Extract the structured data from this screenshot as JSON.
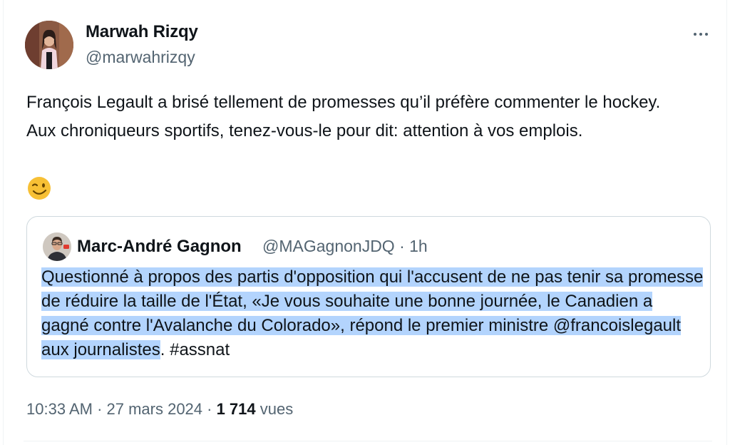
{
  "author": {
    "name": "Marwah Rizqy",
    "handle": "@marwahrizqy"
  },
  "more_menu_icon": "more-horizontal-icon",
  "tweet": {
    "line1": "François Legault a brisé tellement de promesses qu’il préfère commenter le hockey.",
    "line2": "Aux chroniqueurs sportifs, tenez-vous-le pour dit: attention à vos emplois.",
    "emoji_icon": "winking-face-emoji"
  },
  "quoted": {
    "name": "Marc-André Gagnon",
    "meta": "@MAGagnonJDQ · 1h",
    "text_highlighted": "Questionné à propos des partis d'opposition qui l'accusent de ne pas tenir sa promesse de réduire la taille de l'État, «Je vous souhaite une bonne journée, le Canadien a gagné contre l'Avalanche du Colorado», répond le premier ministre @francoislegault aux journalistes",
    "text_rest": ". #assnat"
  },
  "footer": {
    "time_date": "10:33 AM · 27 mars 2024 · ",
    "views_count": "1 714",
    "views_label": " vues"
  },
  "colors": {
    "text": "#0f1419",
    "secondary": "#536471",
    "highlight": "#b3d4fd",
    "border": "#cfd9de"
  }
}
